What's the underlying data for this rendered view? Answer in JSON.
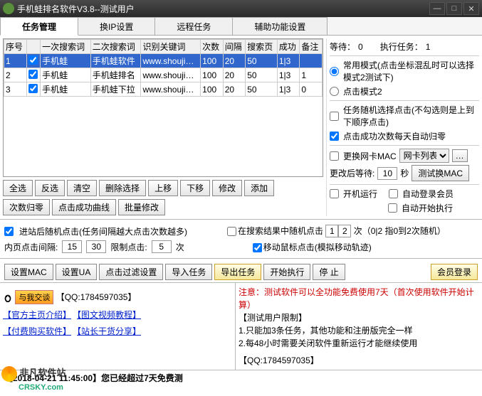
{
  "window": {
    "title": "手机蛙排名软件V3.8--测试用户"
  },
  "tabs": [
    "任务管理",
    "换IP设置",
    "远程任务",
    "辅助功能设置"
  ],
  "table": {
    "headers": [
      "序号",
      "",
      "一次搜索词",
      "二次搜索词",
      "识别关键词",
      "次数",
      "间隔",
      "搜索页",
      "成功",
      "备注"
    ],
    "rows": [
      {
        "n": "1",
        "kw1": "手机蛙",
        "kw2": "手机蛙软件",
        "ident": "www.shouji…",
        "times": "100",
        "gap": "20",
        "pages": "50",
        "ok": "1",
        "succ": "3",
        "note": "",
        "sel": true
      },
      {
        "n": "2",
        "kw1": "手机蛙",
        "kw2": "手机蛙排名",
        "ident": "www.shouji…",
        "times": "100",
        "gap": "20",
        "pages": "50",
        "ok": "1",
        "succ": "3",
        "note": "1",
        "sel": false
      },
      {
        "n": "3",
        "kw1": "手机蛙",
        "kw2": "手机蛙下拉",
        "ident": "www.shouji…",
        "times": "100",
        "gap": "20",
        "pages": "50",
        "ok": "1",
        "succ": "3",
        "note": "0",
        "sel": false
      }
    ]
  },
  "leftBtns1": [
    "全选",
    "反选",
    "清空",
    "删除选择",
    "上移",
    "下移",
    "修改",
    "添加"
  ],
  "leftBtns2": [
    "次数归零",
    "点击成功曲线",
    "批量修改"
  ],
  "right": {
    "wait_label": "等待：",
    "wait_val": "0",
    "exec_label": "执行任务：",
    "exec_val": "1",
    "mode1": "常用模式(点击坐标混乱时可以选择模式2测试下)",
    "mode2": "点击模式2",
    "opt1": "任务随机选择点击(不勾选则是上到下顺序点击)",
    "opt2": "点击成功次数每天自动归零",
    "mac_chk": "更换网卡MAC",
    "mac_combo": "网卡列表",
    "after_label": "更改后等待:",
    "after_val": "10",
    "after_unit": "秒",
    "mac_btn": "测试换MAC",
    "boot": "开机运行",
    "autologin": "自动登录会员",
    "autostart": "自动开始执行"
  },
  "mid": {
    "enter_chk": "进站后随机点击(任务间隔越大点击次数越多)",
    "inner_label": "内页点击间隔:",
    "v1": "15",
    "v2": "30",
    "limit_label": "限制点击:",
    "v3": "5",
    "unit": "次",
    "search_chk": "在搜索结果中随机点击",
    "s1": "1",
    "s2": "2",
    "s_tail": "次（0|2 指0到2次随机）",
    "move_chk": "移动鼠标点击(模拟移动轨迹)"
  },
  "bar": {
    "b1": "设置MAC",
    "b2": "设置UA",
    "b3": "点击过滤设置",
    "b4": "导入任务",
    "b5": "导出任务",
    "b6": "开始执行",
    "b7": "停 止",
    "b8": "会员登录"
  },
  "info": {
    "qq_badge": "与我交谈",
    "qq1": "【QQ:1784597035】",
    "l1": "【官方主页介绍】",
    "l2": "【图文视频教程】",
    "l3": "【付费购买软件】",
    "l4": "【站长干货分享】",
    "r1": "注意：测试软件可以全功能免费使用7天（首次使用软件开始计算）",
    "r2": "【测试用户限制】",
    "r3": "1.只能加3条任务，其他功能和注册版完全一样",
    "r4": "2.每48小时需要关闭软件重新运行才能继续使用",
    "r5": "【QQ:1784597035】"
  },
  "status": "【2018-04-21 11:45:00】您已经超过7天免费测",
  "logo": {
    "cn": "非凡软件站",
    "url": "CRSKY.com"
  }
}
